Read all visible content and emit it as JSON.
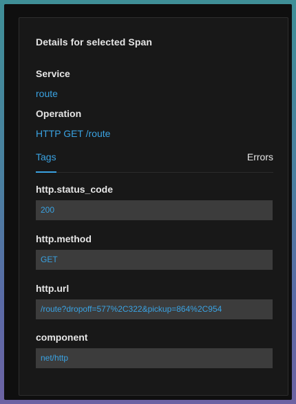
{
  "panel": {
    "title": "Details for selected Span"
  },
  "service": {
    "label": "Service",
    "value": "route"
  },
  "operation": {
    "label": "Operation",
    "value": "HTTP GET /route"
  },
  "tabs": [
    {
      "label": "Tags",
      "active": true
    },
    {
      "label": "Errors",
      "active": false
    }
  ],
  "tags": [
    {
      "key": "http.status_code",
      "value": "200"
    },
    {
      "key": "http.method",
      "value": "GET"
    },
    {
      "key": "http.url",
      "value": "/route?dropoff=577%2C322&pickup=864%2C954"
    },
    {
      "key": "component",
      "value": "net/http"
    }
  ],
  "colors": {
    "accent": "#3aa3e3",
    "panel_background": "#181818",
    "value_background": "#3c3c3c",
    "text": "#e6e6e6"
  }
}
